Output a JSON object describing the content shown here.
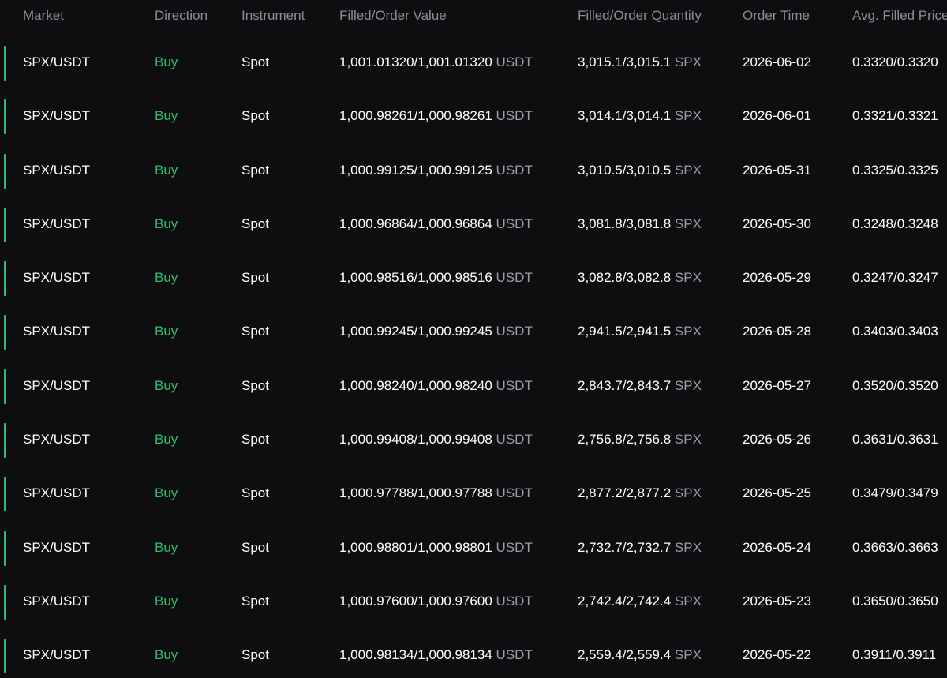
{
  "columns": {
    "market": "Market",
    "direction": "Direction",
    "instrument": "Instrument",
    "filled_order_value": "Filled/Order Value",
    "filled_order_quantity": "Filled/Order Quantity",
    "order_time": "Order Time",
    "avg_filled_price": "Avg. Filled Price"
  },
  "colors": {
    "buy": "#2ebd6e",
    "row_marker": "#2ebd6e",
    "header_text": "#8a8d94",
    "unit_text": "#9a9da4",
    "background": "#0e0e11"
  },
  "rows": [
    {
      "market": "SPX/USDT",
      "direction": "Buy",
      "instrument": "Spot",
      "value": "1,001.01320/1,001.01320",
      "value_unit": "USDT",
      "quantity": "3,015.1/3,015.1",
      "quantity_unit": "SPX",
      "time": "2026-06-02",
      "avg_price": "0.3320/0.3320"
    },
    {
      "market": "SPX/USDT",
      "direction": "Buy",
      "instrument": "Spot",
      "value": "1,000.98261/1,000.98261",
      "value_unit": "USDT",
      "quantity": "3,014.1/3,014.1",
      "quantity_unit": "SPX",
      "time": "2026-06-01",
      "avg_price": "0.3321/0.3321"
    },
    {
      "market": "SPX/USDT",
      "direction": "Buy",
      "instrument": "Spot",
      "value": "1,000.99125/1,000.99125",
      "value_unit": "USDT",
      "quantity": "3,010.5/3,010.5",
      "quantity_unit": "SPX",
      "time": "2026-05-31",
      "avg_price": "0.3325/0.3325"
    },
    {
      "market": "SPX/USDT",
      "direction": "Buy",
      "instrument": "Spot",
      "value": "1,000.96864/1,000.96864",
      "value_unit": "USDT",
      "quantity": "3,081.8/3,081.8",
      "quantity_unit": "SPX",
      "time": "2026-05-30",
      "avg_price": "0.3248/0.3248"
    },
    {
      "market": "SPX/USDT",
      "direction": "Buy",
      "instrument": "Spot",
      "value": "1,000.98516/1,000.98516",
      "value_unit": "USDT",
      "quantity": "3,082.8/3,082.8",
      "quantity_unit": "SPX",
      "time": "2026-05-29",
      "avg_price": "0.3247/0.3247"
    },
    {
      "market": "SPX/USDT",
      "direction": "Buy",
      "instrument": "Spot",
      "value": "1,000.99245/1,000.99245",
      "value_unit": "USDT",
      "quantity": "2,941.5/2,941.5",
      "quantity_unit": "SPX",
      "time": "2026-05-28",
      "avg_price": "0.3403/0.3403"
    },
    {
      "market": "SPX/USDT",
      "direction": "Buy",
      "instrument": "Spot",
      "value": "1,000.98240/1,000.98240",
      "value_unit": "USDT",
      "quantity": "2,843.7/2,843.7",
      "quantity_unit": "SPX",
      "time": "2026-05-27",
      "avg_price": "0.3520/0.3520"
    },
    {
      "market": "SPX/USDT",
      "direction": "Buy",
      "instrument": "Spot",
      "value": "1,000.99408/1,000.99408",
      "value_unit": "USDT",
      "quantity": "2,756.8/2,756.8",
      "quantity_unit": "SPX",
      "time": "2026-05-26",
      "avg_price": "0.3631/0.3631"
    },
    {
      "market": "SPX/USDT",
      "direction": "Buy",
      "instrument": "Spot",
      "value": "1,000.97788/1,000.97788",
      "value_unit": "USDT",
      "quantity": "2,877.2/2,877.2",
      "quantity_unit": "SPX",
      "time": "2026-05-25",
      "avg_price": "0.3479/0.3479"
    },
    {
      "market": "SPX/USDT",
      "direction": "Buy",
      "instrument": "Spot",
      "value": "1,000.98801/1,000.98801",
      "value_unit": "USDT",
      "quantity": "2,732.7/2,732.7",
      "quantity_unit": "SPX",
      "time": "2026-05-24",
      "avg_price": "0.3663/0.3663"
    },
    {
      "market": "SPX/USDT",
      "direction": "Buy",
      "instrument": "Spot",
      "value": "1,000.97600/1,000.97600",
      "value_unit": "USDT",
      "quantity": "2,742.4/2,742.4",
      "quantity_unit": "SPX",
      "time": "2026-05-23",
      "avg_price": "0.3650/0.3650"
    },
    {
      "market": "SPX/USDT",
      "direction": "Buy",
      "instrument": "Spot",
      "value": "1,000.98134/1,000.98134",
      "value_unit": "USDT",
      "quantity": "2,559.4/2,559.4",
      "quantity_unit": "SPX",
      "time": "2026-05-22",
      "avg_price": "0.3911/0.3911"
    }
  ]
}
